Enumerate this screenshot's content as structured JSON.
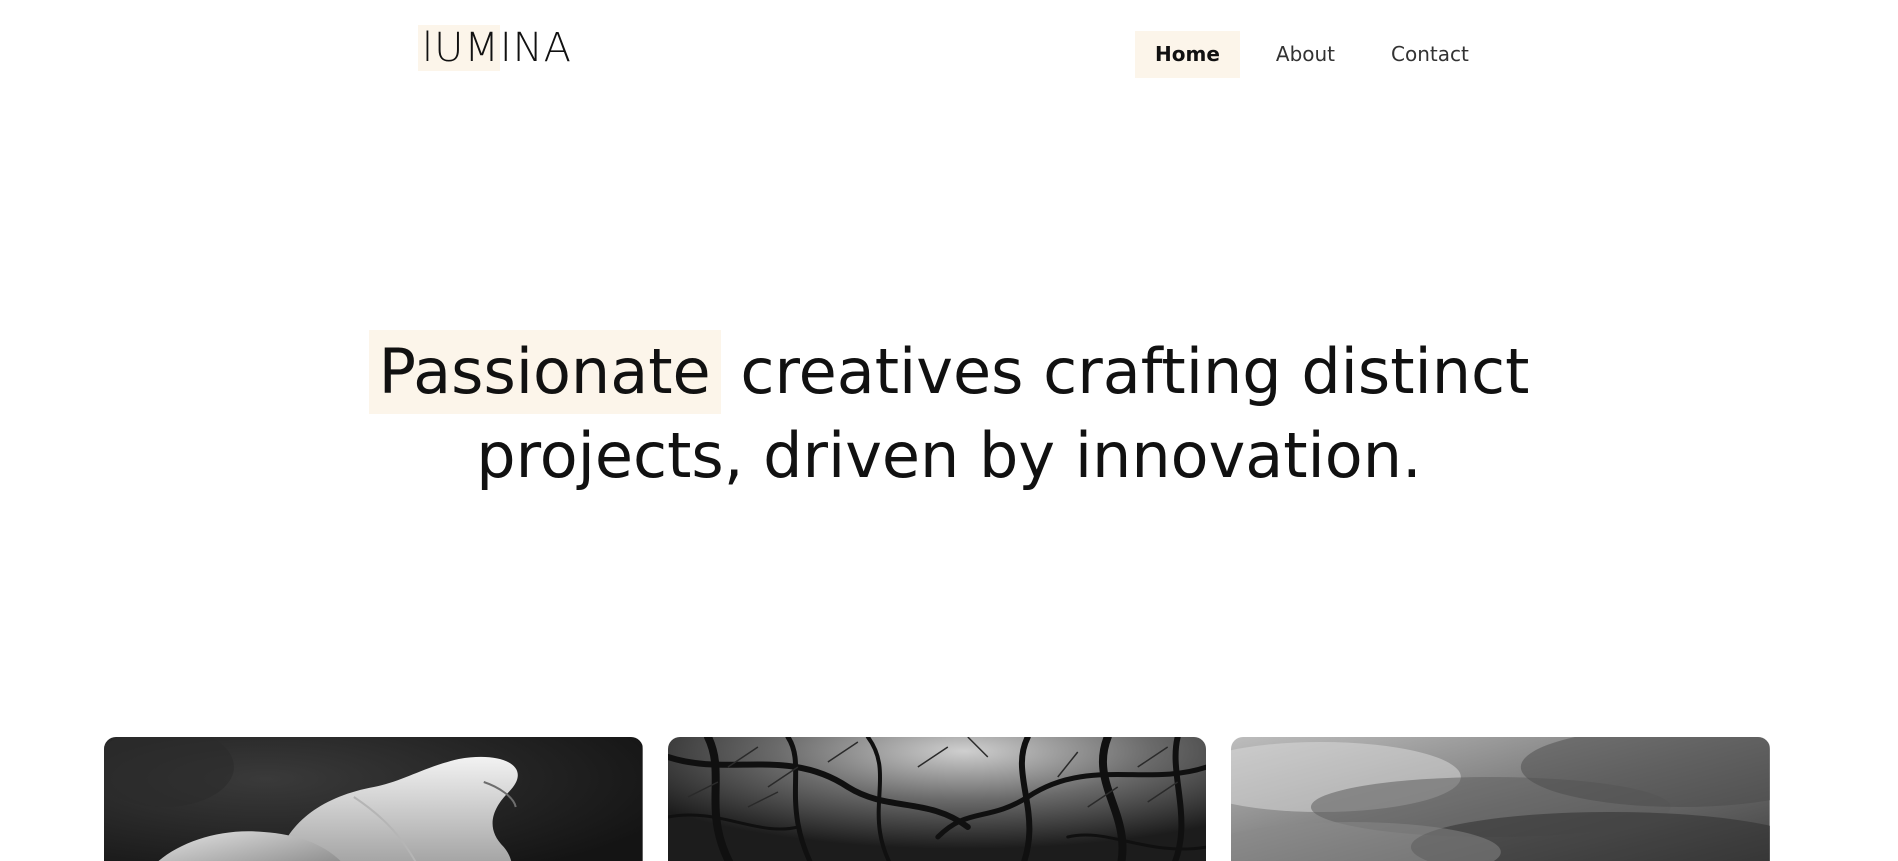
{
  "brand": {
    "logo_highlight": "lUM",
    "logo_rest": "INA",
    "accent_bg": "#fcf5ea"
  },
  "nav": {
    "items": [
      {
        "label": "Home",
        "active": true
      },
      {
        "label": "About",
        "active": false
      },
      {
        "label": "Contact",
        "active": false
      }
    ]
  },
  "hero": {
    "highlight": "Passionate",
    "line1_rest": "creatives crafting distinct",
    "line2": "projects, driven by innovation."
  },
  "gallery": {
    "images": [
      {
        "name": "flower-photo",
        "description_icon": "image-icon"
      },
      {
        "name": "trees-photo",
        "description_icon": "image-icon"
      },
      {
        "name": "sky-photo",
        "description_icon": "image-icon"
      }
    ]
  }
}
